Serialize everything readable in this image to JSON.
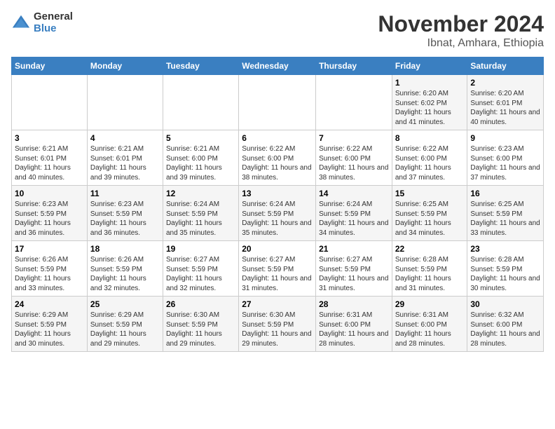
{
  "logo": {
    "general": "General",
    "blue": "Blue"
  },
  "header": {
    "month": "November 2024",
    "location": "Ibnat, Amhara, Ethiopia"
  },
  "weekdays": [
    "Sunday",
    "Monday",
    "Tuesday",
    "Wednesday",
    "Thursday",
    "Friday",
    "Saturday"
  ],
  "weeks": [
    [
      {
        "day": "",
        "sunrise": "",
        "sunset": "",
        "daylight": ""
      },
      {
        "day": "",
        "sunrise": "",
        "sunset": "",
        "daylight": ""
      },
      {
        "day": "",
        "sunrise": "",
        "sunset": "",
        "daylight": ""
      },
      {
        "day": "",
        "sunrise": "",
        "sunset": "",
        "daylight": ""
      },
      {
        "day": "",
        "sunrise": "",
        "sunset": "",
        "daylight": ""
      },
      {
        "day": "1",
        "sunrise": "Sunrise: 6:20 AM",
        "sunset": "Sunset: 6:02 PM",
        "daylight": "Daylight: 11 hours and 41 minutes."
      },
      {
        "day": "2",
        "sunrise": "Sunrise: 6:20 AM",
        "sunset": "Sunset: 6:01 PM",
        "daylight": "Daylight: 11 hours and 40 minutes."
      }
    ],
    [
      {
        "day": "3",
        "sunrise": "Sunrise: 6:21 AM",
        "sunset": "Sunset: 6:01 PM",
        "daylight": "Daylight: 11 hours and 40 minutes."
      },
      {
        "day": "4",
        "sunrise": "Sunrise: 6:21 AM",
        "sunset": "Sunset: 6:01 PM",
        "daylight": "Daylight: 11 hours and 39 minutes."
      },
      {
        "day": "5",
        "sunrise": "Sunrise: 6:21 AM",
        "sunset": "Sunset: 6:00 PM",
        "daylight": "Daylight: 11 hours and 39 minutes."
      },
      {
        "day": "6",
        "sunrise": "Sunrise: 6:22 AM",
        "sunset": "Sunset: 6:00 PM",
        "daylight": "Daylight: 11 hours and 38 minutes."
      },
      {
        "day": "7",
        "sunrise": "Sunrise: 6:22 AM",
        "sunset": "Sunset: 6:00 PM",
        "daylight": "Daylight: 11 hours and 38 minutes."
      },
      {
        "day": "8",
        "sunrise": "Sunrise: 6:22 AM",
        "sunset": "Sunset: 6:00 PM",
        "daylight": "Daylight: 11 hours and 37 minutes."
      },
      {
        "day": "9",
        "sunrise": "Sunrise: 6:23 AM",
        "sunset": "Sunset: 6:00 PM",
        "daylight": "Daylight: 11 hours and 37 minutes."
      }
    ],
    [
      {
        "day": "10",
        "sunrise": "Sunrise: 6:23 AM",
        "sunset": "Sunset: 5:59 PM",
        "daylight": "Daylight: 11 hours and 36 minutes."
      },
      {
        "day": "11",
        "sunrise": "Sunrise: 6:23 AM",
        "sunset": "Sunset: 5:59 PM",
        "daylight": "Daylight: 11 hours and 36 minutes."
      },
      {
        "day": "12",
        "sunrise": "Sunrise: 6:24 AM",
        "sunset": "Sunset: 5:59 PM",
        "daylight": "Daylight: 11 hours and 35 minutes."
      },
      {
        "day": "13",
        "sunrise": "Sunrise: 6:24 AM",
        "sunset": "Sunset: 5:59 PM",
        "daylight": "Daylight: 11 hours and 35 minutes."
      },
      {
        "day": "14",
        "sunrise": "Sunrise: 6:24 AM",
        "sunset": "Sunset: 5:59 PM",
        "daylight": "Daylight: 11 hours and 34 minutes."
      },
      {
        "day": "15",
        "sunrise": "Sunrise: 6:25 AM",
        "sunset": "Sunset: 5:59 PM",
        "daylight": "Daylight: 11 hours and 34 minutes."
      },
      {
        "day": "16",
        "sunrise": "Sunrise: 6:25 AM",
        "sunset": "Sunset: 5:59 PM",
        "daylight": "Daylight: 11 hours and 33 minutes."
      }
    ],
    [
      {
        "day": "17",
        "sunrise": "Sunrise: 6:26 AM",
        "sunset": "Sunset: 5:59 PM",
        "daylight": "Daylight: 11 hours and 33 minutes."
      },
      {
        "day": "18",
        "sunrise": "Sunrise: 6:26 AM",
        "sunset": "Sunset: 5:59 PM",
        "daylight": "Daylight: 11 hours and 32 minutes."
      },
      {
        "day": "19",
        "sunrise": "Sunrise: 6:27 AM",
        "sunset": "Sunset: 5:59 PM",
        "daylight": "Daylight: 11 hours and 32 minutes."
      },
      {
        "day": "20",
        "sunrise": "Sunrise: 6:27 AM",
        "sunset": "Sunset: 5:59 PM",
        "daylight": "Daylight: 11 hours and 31 minutes."
      },
      {
        "day": "21",
        "sunrise": "Sunrise: 6:27 AM",
        "sunset": "Sunset: 5:59 PM",
        "daylight": "Daylight: 11 hours and 31 minutes."
      },
      {
        "day": "22",
        "sunrise": "Sunrise: 6:28 AM",
        "sunset": "Sunset: 5:59 PM",
        "daylight": "Daylight: 11 hours and 31 minutes."
      },
      {
        "day": "23",
        "sunrise": "Sunrise: 6:28 AM",
        "sunset": "Sunset: 5:59 PM",
        "daylight": "Daylight: 11 hours and 30 minutes."
      }
    ],
    [
      {
        "day": "24",
        "sunrise": "Sunrise: 6:29 AM",
        "sunset": "Sunset: 5:59 PM",
        "daylight": "Daylight: 11 hours and 30 minutes."
      },
      {
        "day": "25",
        "sunrise": "Sunrise: 6:29 AM",
        "sunset": "Sunset: 5:59 PM",
        "daylight": "Daylight: 11 hours and 29 minutes."
      },
      {
        "day": "26",
        "sunrise": "Sunrise: 6:30 AM",
        "sunset": "Sunset: 5:59 PM",
        "daylight": "Daylight: 11 hours and 29 minutes."
      },
      {
        "day": "27",
        "sunrise": "Sunrise: 6:30 AM",
        "sunset": "Sunset: 5:59 PM",
        "daylight": "Daylight: 11 hours and 29 minutes."
      },
      {
        "day": "28",
        "sunrise": "Sunrise: 6:31 AM",
        "sunset": "Sunset: 6:00 PM",
        "daylight": "Daylight: 11 hours and 28 minutes."
      },
      {
        "day": "29",
        "sunrise": "Sunrise: 6:31 AM",
        "sunset": "Sunset: 6:00 PM",
        "daylight": "Daylight: 11 hours and 28 minutes."
      },
      {
        "day": "30",
        "sunrise": "Sunrise: 6:32 AM",
        "sunset": "Sunset: 6:00 PM",
        "daylight": "Daylight: 11 hours and 28 minutes."
      }
    ]
  ]
}
